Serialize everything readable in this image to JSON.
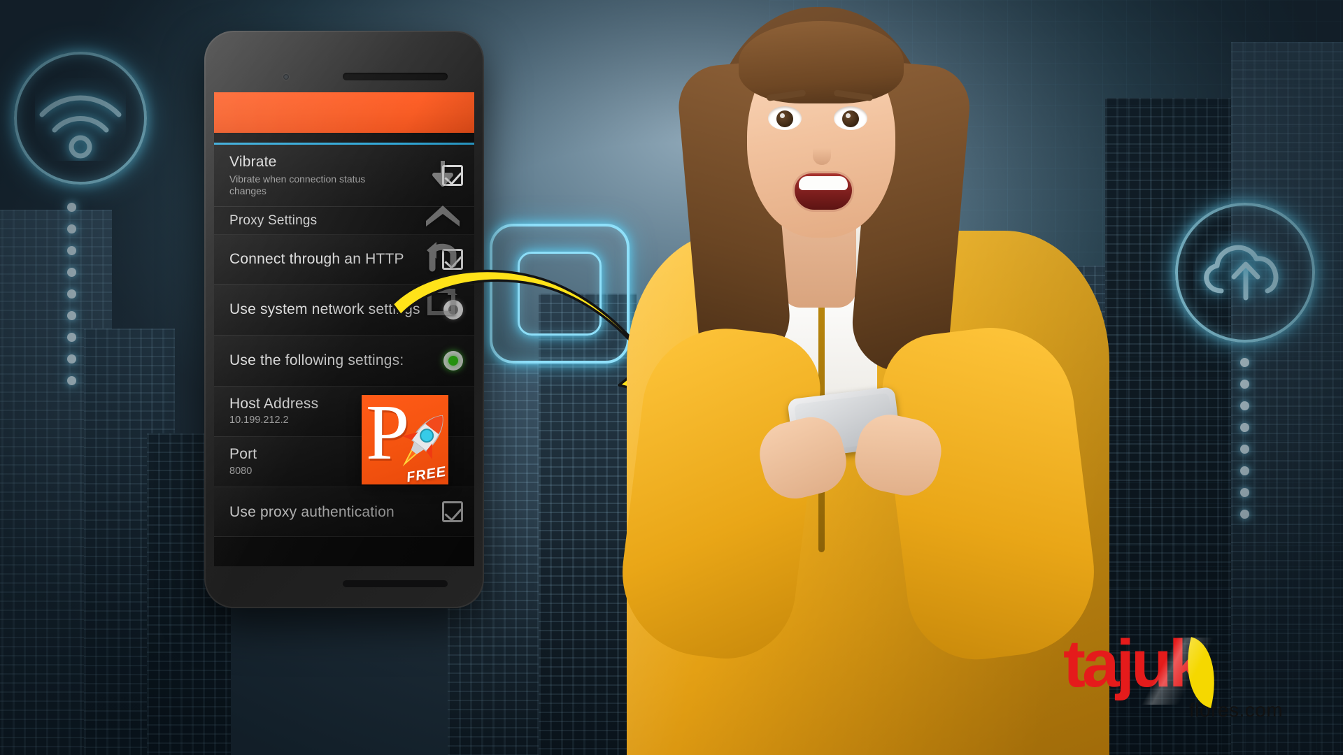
{
  "background": {
    "scene": "night-city-skyline",
    "accent_neon": "#9ce6fb",
    "icons": [
      {
        "name": "wifi-icon",
        "label": "WiFi"
      },
      {
        "name": "cloud-upload-icon",
        "label": "Cloud Upload"
      },
      {
        "name": "device-square-icon",
        "label": "Device"
      }
    ]
  },
  "phone": {
    "device": "smartphone-mockup",
    "screen": {
      "app_bar": {
        "color": "#ff5a20",
        "title": ""
      },
      "accent_rule": "#2aa5d6",
      "settings": [
        {
          "name": "vibrate",
          "title": "Vibrate",
          "subtitle": "Vibrate when connection status changes",
          "control": "checkbox",
          "checked": true
        },
        {
          "name": "proxy-settings-header",
          "title": "Proxy Settings",
          "subtitle": "",
          "control": "none",
          "checked": false
        },
        {
          "name": "connect-through-http",
          "title": "Connect through an HTTP",
          "subtitle": "",
          "control": "checkbox",
          "checked": true
        },
        {
          "name": "use-system-network-settings",
          "title": "Use system network settings",
          "subtitle": "",
          "control": "radio",
          "selected": false
        },
        {
          "name": "use-the-following-settings",
          "title": "Use the following settings:",
          "subtitle": "",
          "control": "radio",
          "selected": true
        },
        {
          "name": "host-address",
          "title": "Host Address",
          "subtitle": "10.199.212.2",
          "control": "none",
          "checked": false
        },
        {
          "name": "port",
          "title": "Port",
          "subtitle": "8080",
          "control": "none",
          "checked": false
        },
        {
          "name": "use-proxy-authentication",
          "title": "Use proxy authentication",
          "subtitle": "",
          "control": "checkbox",
          "checked": true
        }
      ]
    },
    "nav_overlay": [
      {
        "name": "download-arrow-icon"
      },
      {
        "name": "home-icon"
      },
      {
        "name": "back-arrow-icon"
      },
      {
        "name": "recent-apps-icon"
      }
    ]
  },
  "app_icon": {
    "letter": "P",
    "badge": "FREE",
    "background_color": "#ff5b18",
    "glyphs": {
      "rocket": "rocket-icon"
    }
  },
  "annotation": {
    "arrow": {
      "name": "curved-yellow-arrow",
      "color": "#ffe319",
      "outline": "#1a1a1a"
    }
  },
  "person": {
    "name": "smiling-woman-with-phone",
    "jacket_color": "#f5b524"
  },
  "logo": {
    "word": "tajuk",
    "sub": "flores.com",
    "color": "#e51b1b",
    "leaf_color": "#f5d800"
  }
}
